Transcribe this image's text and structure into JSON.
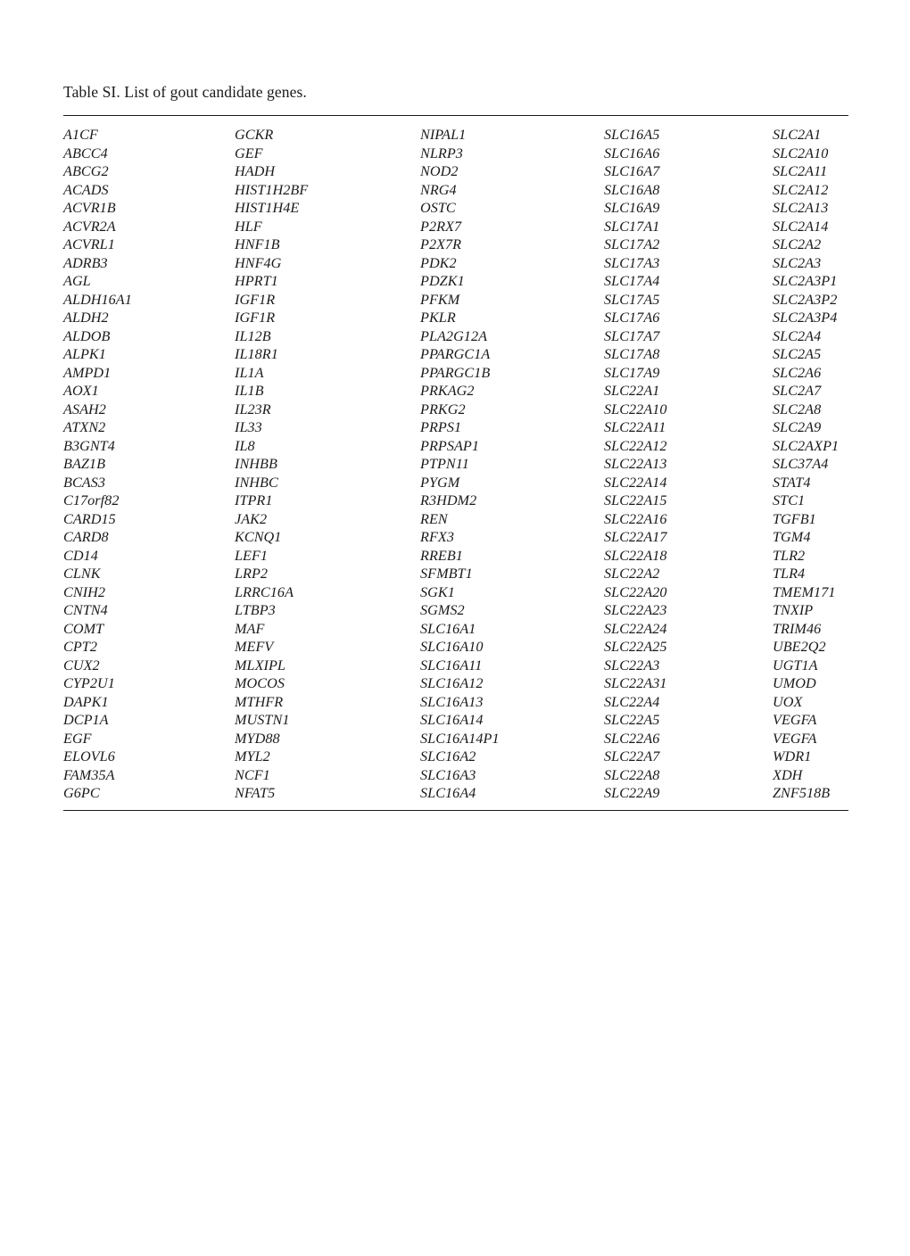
{
  "document": {
    "caption": "Table SI. List of gout candidate genes.",
    "rows_per_column": 38,
    "column_count": 5,
    "total_entries": 190,
    "rule_color": "#1a1a1a",
    "text_color": "#1a1a1a",
    "background_color": "#ffffff"
  },
  "table": {
    "columns": [
      {
        "index": 0,
        "genes": [
          "A1CF",
          "ABCC4",
          "ABCG2",
          "ACADS",
          "ACVR1B",
          "ACVR2A",
          "ACVRL1",
          "ADRB3",
          "AGL",
          "ALDH16A1",
          "ALDH2",
          "ALDOB",
          "ALPK1",
          "AMPD1",
          "AOX1",
          "ASAH2",
          "ATXN2",
          "B3GNT4",
          "BAZ1B",
          "BCAS3",
          "C17orf82",
          "CARD15",
          "CARD8",
          "CD14",
          "CLNK",
          "CNIH2",
          "CNTN4",
          "COMT",
          "CPT2",
          "CUX2",
          "CYP2U1",
          "DAPK1",
          "DCP1A",
          "EGF",
          "ELOVL6",
          "FAM35A",
          "G6PC"
        ]
      },
      {
        "index": 1,
        "genes": [
          "GCKR",
          "GEF",
          "HADH",
          "HIST1H2BF",
          "HIST1H4E",
          "HLF",
          "HNF1B",
          "HNF4G",
          "HPRT1",
          "IGF1R",
          "IGF1R",
          "IL12B",
          "IL18R1",
          "IL1A",
          "IL1B",
          "IL23R",
          "IL33",
          "IL8",
          "INHBB",
          "INHBC",
          "ITPR1",
          "JAK2",
          "KCNQ1",
          "LEF1",
          "LRP2",
          "LRRC16A",
          "LTBP3",
          "MAF",
          "MEFV",
          "MLXIPL",
          "MOCOS",
          "MTHFR",
          "MUSTN1",
          "MYD88",
          "MYL2",
          "NCF1",
          "NFAT5"
        ]
      },
      {
        "index": 2,
        "genes": [
          "NIPAL1",
          "NLRP3",
          "NOD2",
          "NRG4",
          "OSTC",
          "P2RX7",
          "P2X7R",
          "PDK2",
          "PDZK1",
          "PFKM",
          "PKLR",
          "PLA2G12A",
          "PPARGC1A",
          "PPARGC1B",
          "PRKAG2",
          "PRKG2",
          "PRPS1",
          "PRPSAP1",
          "PTPN11",
          "PYGM",
          "R3HDM2",
          "REN",
          "RFX3",
          "RREB1",
          "SFMBT1",
          "SGK1",
          "SGMS2",
          "SLC16A1",
          "SLC16A10",
          "SLC16A11",
          "SLC16A12",
          "SLC16A13",
          "SLC16A14",
          "SLC16A14P1",
          "SLC16A2",
          "SLC16A3",
          "SLC16A4"
        ]
      },
      {
        "index": 3,
        "genes": [
          "SLC16A5",
          "SLC16A6",
          "SLC16A7",
          "SLC16A8",
          "SLC16A9",
          "SLC17A1",
          "SLC17A2",
          "SLC17A3",
          "SLC17A4",
          "SLC17A5",
          "SLC17A6",
          "SLC17A7",
          "SLC17A8",
          "SLC17A9",
          "SLC22A1",
          "SLC22A10",
          "SLC22A11",
          "SLC22A12",
          "SLC22A13",
          "SLC22A14",
          "SLC22A15",
          "SLC22A16",
          "SLC22A17",
          "SLC22A18",
          "SLC22A2",
          "SLC22A20",
          "SLC22A23",
          "SLC22A24",
          "SLC22A25",
          "SLC22A3",
          "SLC22A31",
          "SLC22A4",
          "SLC22A5",
          "SLC22A6",
          "SLC22A7",
          "SLC22A8",
          "SLC22A9"
        ]
      },
      {
        "index": 4,
        "genes": [
          "SLC2A1",
          "SLC2A10",
          "SLC2A11",
          "SLC2A12",
          "SLC2A13",
          "SLC2A14",
          "SLC2A2",
          "SLC2A3",
          "SLC2A3P1",
          "SLC2A3P2",
          "SLC2A3P4",
          "SLC2A4",
          "SLC2A5",
          "SLC2A6",
          "SLC2A7",
          "SLC2A8",
          "SLC2A9",
          "SLC2AXP1",
          "SLC37A4",
          "STAT4",
          "STC1",
          "TGFB1",
          "TGM4",
          "TLR2",
          "TLR4",
          "TMEM171",
          "TNXIP",
          "TRIM46",
          "UBE2Q2",
          "UGT1A",
          "UMOD",
          "UOX",
          "VEGFA",
          "VEGFA",
          "WDR1",
          "XDH",
          "ZNF518B"
        ]
      }
    ]
  }
}
